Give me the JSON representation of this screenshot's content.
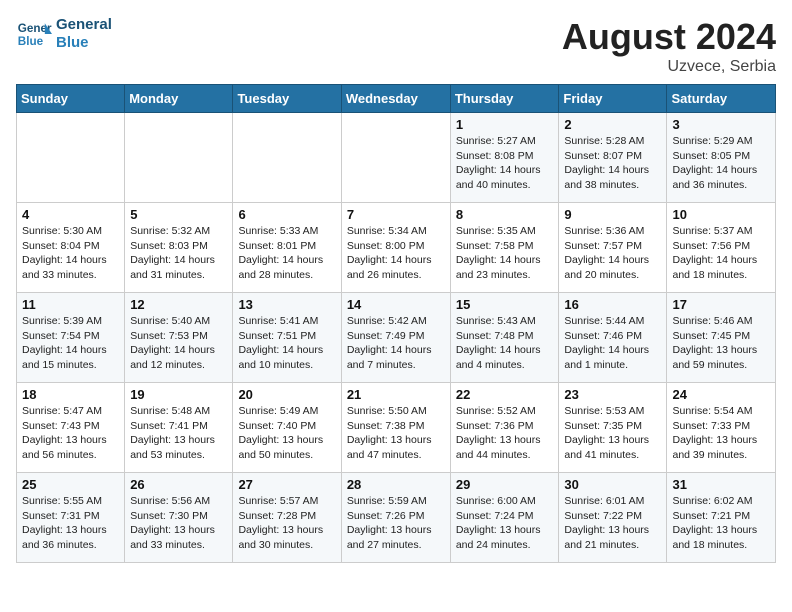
{
  "header": {
    "logo_general": "General",
    "logo_blue": "Blue",
    "month_year": "August 2024",
    "location": "Uzvece, Serbia"
  },
  "days_of_week": [
    "Sunday",
    "Monday",
    "Tuesday",
    "Wednesday",
    "Thursday",
    "Friday",
    "Saturday"
  ],
  "weeks": [
    [
      {
        "day": "",
        "sunrise": "",
        "sunset": "",
        "daylight": ""
      },
      {
        "day": "",
        "sunrise": "",
        "sunset": "",
        "daylight": ""
      },
      {
        "day": "",
        "sunrise": "",
        "sunset": "",
        "daylight": ""
      },
      {
        "day": "",
        "sunrise": "",
        "sunset": "",
        "daylight": ""
      },
      {
        "day": "1",
        "sunrise": "Sunrise: 5:27 AM",
        "sunset": "Sunset: 8:08 PM",
        "daylight": "Daylight: 14 hours and 40 minutes."
      },
      {
        "day": "2",
        "sunrise": "Sunrise: 5:28 AM",
        "sunset": "Sunset: 8:07 PM",
        "daylight": "Daylight: 14 hours and 38 minutes."
      },
      {
        "day": "3",
        "sunrise": "Sunrise: 5:29 AM",
        "sunset": "Sunset: 8:05 PM",
        "daylight": "Daylight: 14 hours and 36 minutes."
      }
    ],
    [
      {
        "day": "4",
        "sunrise": "Sunrise: 5:30 AM",
        "sunset": "Sunset: 8:04 PM",
        "daylight": "Daylight: 14 hours and 33 minutes."
      },
      {
        "day": "5",
        "sunrise": "Sunrise: 5:32 AM",
        "sunset": "Sunset: 8:03 PM",
        "daylight": "Daylight: 14 hours and 31 minutes."
      },
      {
        "day": "6",
        "sunrise": "Sunrise: 5:33 AM",
        "sunset": "Sunset: 8:01 PM",
        "daylight": "Daylight: 14 hours and 28 minutes."
      },
      {
        "day": "7",
        "sunrise": "Sunrise: 5:34 AM",
        "sunset": "Sunset: 8:00 PM",
        "daylight": "Daylight: 14 hours and 26 minutes."
      },
      {
        "day": "8",
        "sunrise": "Sunrise: 5:35 AM",
        "sunset": "Sunset: 7:58 PM",
        "daylight": "Daylight: 14 hours and 23 minutes."
      },
      {
        "day": "9",
        "sunrise": "Sunrise: 5:36 AM",
        "sunset": "Sunset: 7:57 PM",
        "daylight": "Daylight: 14 hours and 20 minutes."
      },
      {
        "day": "10",
        "sunrise": "Sunrise: 5:37 AM",
        "sunset": "Sunset: 7:56 PM",
        "daylight": "Daylight: 14 hours and 18 minutes."
      }
    ],
    [
      {
        "day": "11",
        "sunrise": "Sunrise: 5:39 AM",
        "sunset": "Sunset: 7:54 PM",
        "daylight": "Daylight: 14 hours and 15 minutes."
      },
      {
        "day": "12",
        "sunrise": "Sunrise: 5:40 AM",
        "sunset": "Sunset: 7:53 PM",
        "daylight": "Daylight: 14 hours and 12 minutes."
      },
      {
        "day": "13",
        "sunrise": "Sunrise: 5:41 AM",
        "sunset": "Sunset: 7:51 PM",
        "daylight": "Daylight: 14 hours and 10 minutes."
      },
      {
        "day": "14",
        "sunrise": "Sunrise: 5:42 AM",
        "sunset": "Sunset: 7:49 PM",
        "daylight": "Daylight: 14 hours and 7 minutes."
      },
      {
        "day": "15",
        "sunrise": "Sunrise: 5:43 AM",
        "sunset": "Sunset: 7:48 PM",
        "daylight": "Daylight: 14 hours and 4 minutes."
      },
      {
        "day": "16",
        "sunrise": "Sunrise: 5:44 AM",
        "sunset": "Sunset: 7:46 PM",
        "daylight": "Daylight: 14 hours and 1 minute."
      },
      {
        "day": "17",
        "sunrise": "Sunrise: 5:46 AM",
        "sunset": "Sunset: 7:45 PM",
        "daylight": "Daylight: 13 hours and 59 minutes."
      }
    ],
    [
      {
        "day": "18",
        "sunrise": "Sunrise: 5:47 AM",
        "sunset": "Sunset: 7:43 PM",
        "daylight": "Daylight: 13 hours and 56 minutes."
      },
      {
        "day": "19",
        "sunrise": "Sunrise: 5:48 AM",
        "sunset": "Sunset: 7:41 PM",
        "daylight": "Daylight: 13 hours and 53 minutes."
      },
      {
        "day": "20",
        "sunrise": "Sunrise: 5:49 AM",
        "sunset": "Sunset: 7:40 PM",
        "daylight": "Daylight: 13 hours and 50 minutes."
      },
      {
        "day": "21",
        "sunrise": "Sunrise: 5:50 AM",
        "sunset": "Sunset: 7:38 PM",
        "daylight": "Daylight: 13 hours and 47 minutes."
      },
      {
        "day": "22",
        "sunrise": "Sunrise: 5:52 AM",
        "sunset": "Sunset: 7:36 PM",
        "daylight": "Daylight: 13 hours and 44 minutes."
      },
      {
        "day": "23",
        "sunrise": "Sunrise: 5:53 AM",
        "sunset": "Sunset: 7:35 PM",
        "daylight": "Daylight: 13 hours and 41 minutes."
      },
      {
        "day": "24",
        "sunrise": "Sunrise: 5:54 AM",
        "sunset": "Sunset: 7:33 PM",
        "daylight": "Daylight: 13 hours and 39 minutes."
      }
    ],
    [
      {
        "day": "25",
        "sunrise": "Sunrise: 5:55 AM",
        "sunset": "Sunset: 7:31 PM",
        "daylight": "Daylight: 13 hours and 36 minutes."
      },
      {
        "day": "26",
        "sunrise": "Sunrise: 5:56 AM",
        "sunset": "Sunset: 7:30 PM",
        "daylight": "Daylight: 13 hours and 33 minutes."
      },
      {
        "day": "27",
        "sunrise": "Sunrise: 5:57 AM",
        "sunset": "Sunset: 7:28 PM",
        "daylight": "Daylight: 13 hours and 30 minutes."
      },
      {
        "day": "28",
        "sunrise": "Sunrise: 5:59 AM",
        "sunset": "Sunset: 7:26 PM",
        "daylight": "Daylight: 13 hours and 27 minutes."
      },
      {
        "day": "29",
        "sunrise": "Sunrise: 6:00 AM",
        "sunset": "Sunset: 7:24 PM",
        "daylight": "Daylight: 13 hours and 24 minutes."
      },
      {
        "day": "30",
        "sunrise": "Sunrise: 6:01 AM",
        "sunset": "Sunset: 7:22 PM",
        "daylight": "Daylight: 13 hours and 21 minutes."
      },
      {
        "day": "31",
        "sunrise": "Sunrise: 6:02 AM",
        "sunset": "Sunset: 7:21 PM",
        "daylight": "Daylight: 13 hours and 18 minutes."
      }
    ]
  ]
}
